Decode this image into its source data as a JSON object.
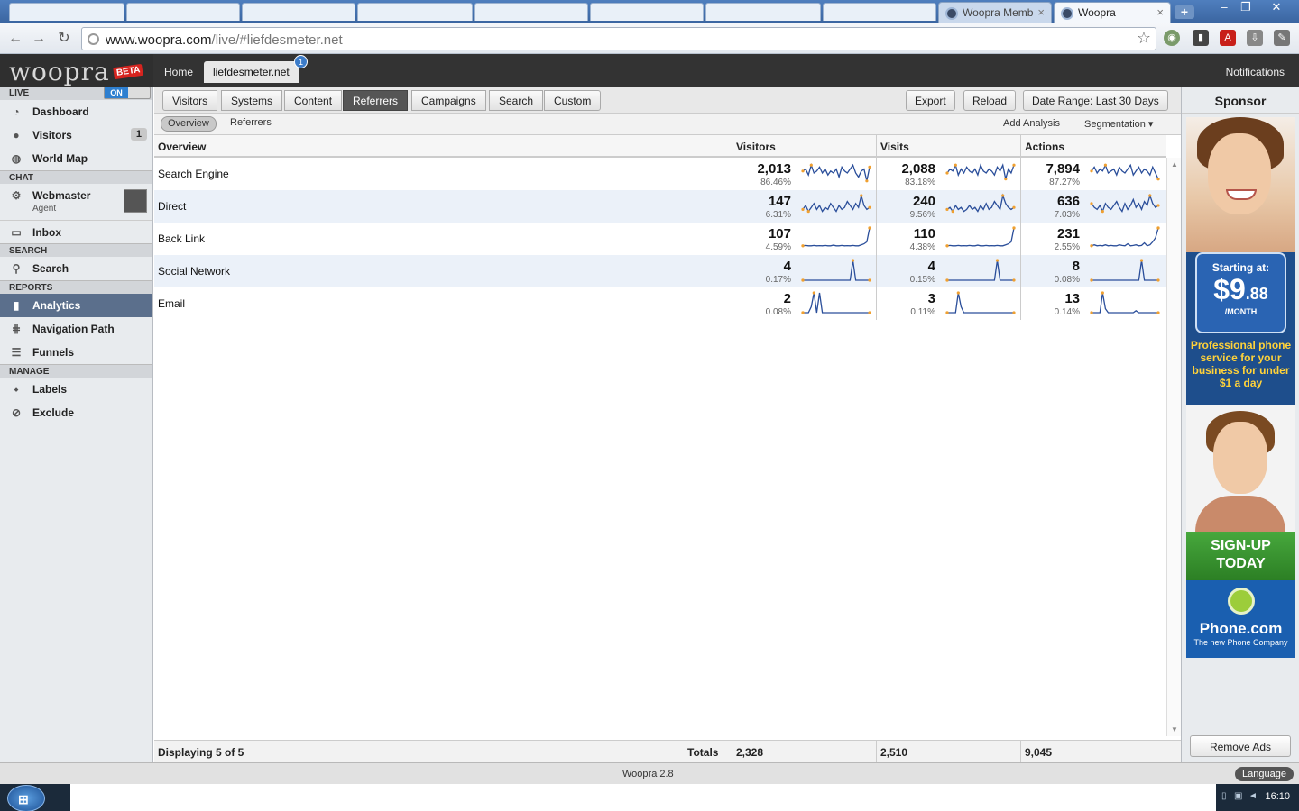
{
  "browser": {
    "tabs": [
      {
        "label": "Woopra Memb",
        "active": false
      },
      {
        "label": "Woopra",
        "active": true
      }
    ],
    "close_glyph": "×",
    "new_tab_glyph": "+",
    "url_host": "www.woopra.com",
    "url_path": "/live/#liefdesmeter.net",
    "window_controls": [
      "–",
      "❐",
      "✕"
    ]
  },
  "app": {
    "logo": "woopra",
    "beta": "BETA",
    "top_tabs": [
      {
        "label": "Home",
        "active": false
      },
      {
        "label": "liefdesmeter.net",
        "active": true,
        "badge": "1"
      }
    ],
    "notifications": "Notifications"
  },
  "sidebar": {
    "live": {
      "label": "LIVE",
      "toggle": "ON"
    },
    "live_items": [
      {
        "label": "Dashboard",
        "icon": "dashboard-icon",
        "glyph": "◔"
      },
      {
        "label": "Visitors",
        "icon": "visitors-icon",
        "glyph": "👥",
        "badge": "1"
      },
      {
        "label": "World Map",
        "icon": "globe-icon",
        "glyph": "◍"
      }
    ],
    "chat": {
      "label": "CHAT",
      "agent_name": "Webmaster",
      "agent_role": "Agent",
      "inbox": "Inbox"
    },
    "search": {
      "label": "SEARCH",
      "item": "Search"
    },
    "reports": {
      "label": "REPORTS",
      "items": [
        {
          "label": "Analytics",
          "icon": "bar-chart-icon",
          "glyph": "▮",
          "active": true
        },
        {
          "label": "Navigation Path",
          "icon": "path-icon",
          "glyph": "⋕",
          "active": false
        },
        {
          "label": "Funnels",
          "icon": "funnel-icon",
          "glyph": "☰",
          "active": false
        }
      ]
    },
    "manage": {
      "label": "MANAGE",
      "items": [
        {
          "label": "Labels",
          "icon": "tag-icon",
          "glyph": "⬩"
        },
        {
          "label": "Exclude",
          "icon": "exclude-icon",
          "glyph": "⊘"
        }
      ]
    }
  },
  "nav": {
    "tabs": [
      {
        "label": "Visitors",
        "active": false
      },
      {
        "label": "Systems",
        "active": false
      },
      {
        "label": "Content",
        "active": false
      },
      {
        "label": "Referrers",
        "active": true
      },
      {
        "label": "Campaigns",
        "active": false
      },
      {
        "label": "Search",
        "active": false
      },
      {
        "label": "Custom",
        "active": false
      }
    ],
    "export": "Export",
    "reload": "Reload",
    "date_range": "Date Range: Last 30 Days"
  },
  "subnav": {
    "tabs": [
      {
        "label": "Overview",
        "active": true
      },
      {
        "label": "Referrers",
        "active": false
      }
    ],
    "add_analysis": "Add Analysis",
    "segmentation": "Segmentation ▾"
  },
  "table": {
    "headers": [
      "Overview",
      "Visitors",
      "Visits",
      "Actions"
    ],
    "rows": [
      {
        "label": "Search Engine",
        "cells": [
          {
            "value": "2,013",
            "pct": "86.46%",
            "spark": [
              0.6,
              0.7,
              0.4,
              0.9,
              0.5,
              0.6,
              0.8,
              0.5,
              0.7,
              0.4,
              0.6,
              0.5,
              0.7,
              0.3,
              0.8,
              0.6,
              0.5,
              0.7,
              0.9,
              0.5,
              0.3,
              0.6,
              0.7,
              0.1,
              0.8
            ]
          },
          {
            "value": "2,088",
            "pct": "83.18%",
            "spark": [
              0.5,
              0.7,
              0.6,
              0.9,
              0.4,
              0.7,
              0.5,
              0.8,
              0.6,
              0.5,
              0.7,
              0.4,
              0.9,
              0.6,
              0.5,
              0.7,
              0.6,
              0.4,
              0.8,
              0.6,
              0.9,
              0.2,
              0.7,
              0.5,
              0.9
            ]
          },
          {
            "value": "7,894",
            "pct": "87.27%",
            "spark": [
              0.6,
              0.8,
              0.5,
              0.7,
              0.6,
              0.9,
              0.5,
              0.6,
              0.7,
              0.4,
              0.8,
              0.6,
              0.5,
              0.7,
              0.9,
              0.4,
              0.6,
              0.8,
              0.5,
              0.7,
              0.6,
              0.4,
              0.8,
              0.5,
              0.2
            ]
          }
        ]
      },
      {
        "label": "Direct",
        "cells": [
          {
            "value": "147",
            "pct": "6.31%",
            "spark": [
              0.3,
              0.5,
              0.2,
              0.4,
              0.6,
              0.3,
              0.5,
              0.2,
              0.4,
              0.3,
              0.6,
              0.4,
              0.2,
              0.5,
              0.3,
              0.4,
              0.7,
              0.5,
              0.3,
              0.6,
              0.4,
              1.0,
              0.5,
              0.3,
              0.4
            ]
          },
          {
            "value": "240",
            "pct": "9.56%",
            "spark": [
              0.3,
              0.4,
              0.2,
              0.5,
              0.3,
              0.4,
              0.2,
              0.3,
              0.5,
              0.3,
              0.4,
              0.2,
              0.5,
              0.3,
              0.6,
              0.3,
              0.4,
              0.7,
              0.5,
              0.3,
              1.0,
              0.6,
              0.4,
              0.3,
              0.4
            ]
          },
          {
            "value": "636",
            "pct": "7.03%",
            "spark": [
              0.6,
              0.4,
              0.3,
              0.5,
              0.2,
              0.6,
              0.4,
              0.3,
              0.5,
              0.7,
              0.4,
              0.2,
              0.6,
              0.3,
              0.5,
              0.8,
              0.4,
              0.6,
              0.3,
              0.7,
              0.5,
              1.0,
              0.6,
              0.4,
              0.5
            ]
          }
        ]
      },
      {
        "label": "Back Link",
        "cells": [
          {
            "value": "107",
            "pct": "4.59%",
            "spark": [
              0.1,
              0.12,
              0.1,
              0.1,
              0.12,
              0.1,
              0.11,
              0.1,
              0.12,
              0.1,
              0.1,
              0.13,
              0.1,
              0.1,
              0.12,
              0.1,
              0.11,
              0.1,
              0.12,
              0.1,
              0.1,
              0.15,
              0.2,
              0.3,
              1.0
            ]
          },
          {
            "value": "110",
            "pct": "4.38%",
            "spark": [
              0.1,
              0.12,
              0.1,
              0.1,
              0.12,
              0.1,
              0.11,
              0.1,
              0.12,
              0.1,
              0.1,
              0.13,
              0.1,
              0.1,
              0.12,
              0.1,
              0.11,
              0.1,
              0.12,
              0.1,
              0.1,
              0.15,
              0.2,
              0.3,
              1.0
            ]
          },
          {
            "value": "231",
            "pct": "2.55%",
            "spark": [
              0.1,
              0.15,
              0.1,
              0.12,
              0.1,
              0.15,
              0.1,
              0.12,
              0.1,
              0.1,
              0.15,
              0.12,
              0.1,
              0.2,
              0.1,
              0.12,
              0.15,
              0.1,
              0.12,
              0.25,
              0.1,
              0.15,
              0.3,
              0.5,
              1.0
            ]
          }
        ]
      },
      {
        "label": "Social Network",
        "cells": [
          {
            "value": "4",
            "pct": "0.17%",
            "spark": [
              0,
              0,
              0,
              0,
              0,
              0,
              0,
              0,
              0,
              0,
              0,
              0,
              0,
              0,
              0,
              0,
              0,
              0,
              1.0,
              0,
              0,
              0,
              0,
              0,
              0
            ]
          },
          {
            "value": "4",
            "pct": "0.15%",
            "spark": [
              0,
              0,
              0,
              0,
              0,
              0,
              0,
              0,
              0,
              0,
              0,
              0,
              0,
              0,
              0,
              0,
              0,
              0,
              1.0,
              0,
              0,
              0,
              0,
              0,
              0
            ]
          },
          {
            "value": "8",
            "pct": "0.08%",
            "spark": [
              0,
              0,
              0,
              0,
              0,
              0,
              0,
              0,
              0,
              0,
              0,
              0,
              0,
              0,
              0,
              0,
              0,
              0,
              1.0,
              0,
              0,
              0,
              0,
              0,
              0
            ]
          }
        ]
      },
      {
        "label": "Email",
        "cells": [
          {
            "value": "2",
            "pct": "0.08%",
            "spark": [
              0,
              0,
              0,
              0.3,
              1.0,
              0,
              1.0,
              0,
              0,
              0,
              0,
              0,
              0,
              0,
              0,
              0,
              0,
              0,
              0,
              0,
              0,
              0,
              0,
              0,
              0
            ]
          },
          {
            "value": "3",
            "pct": "0.11%",
            "spark": [
              0,
              0,
              0,
              0,
              1.0,
              0.3,
              0,
              0,
              0,
              0,
              0,
              0,
              0,
              0,
              0,
              0,
              0,
              0,
              0,
              0,
              0,
              0,
              0,
              0,
              0
            ]
          },
          {
            "value": "13",
            "pct": "0.14%",
            "spark": [
              0,
              0,
              0,
              0,
              1.0,
              0.2,
              0,
              0,
              0,
              0,
              0,
              0,
              0,
              0,
              0,
              0,
              0.1,
              0,
              0,
              0,
              0,
              0,
              0,
              0,
              0
            ]
          }
        ]
      }
    ],
    "footer": {
      "displaying": "Displaying 5 of 5",
      "totals_label": "Totals",
      "totals": [
        "2,328",
        "2,510",
        "9,045"
      ]
    }
  },
  "sponsor": {
    "title": "Sponsor",
    "ad": {
      "starting_at": "Starting at:",
      "price_main": "$9",
      "price_cents": ".88",
      "per_month": "/MONTH",
      "tagline": "Professional phone service for your business for under $1 a day",
      "signup": "SIGN-UP TODAY",
      "brand": "Phone.com",
      "slogan": "The new Phone Company"
    },
    "remove_ads": "Remove Ads"
  },
  "status": {
    "version": "Woopra 2.8",
    "language": "Language"
  },
  "taskbar": {
    "clock": "16:10"
  },
  "colors": {
    "spark_line": "#2a4e9a",
    "spark_dot": "#f0a030",
    "active_nav": "#555555",
    "row_alt": "#ebf1f9"
  }
}
